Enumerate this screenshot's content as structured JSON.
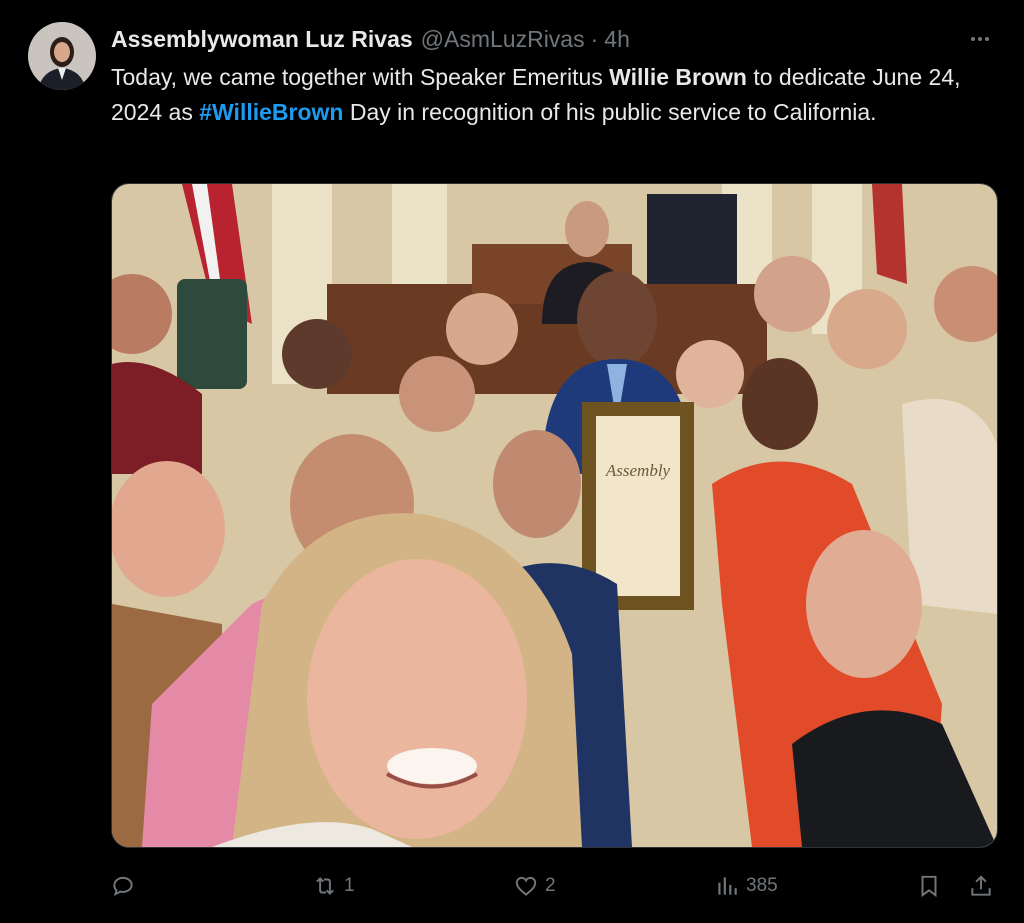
{
  "tweet": {
    "author_name": "Assemblywoman Luz Rivas",
    "handle": "@AsmLuzRivas",
    "separator": "·",
    "time": "4h",
    "text_part1": "Today, we came together with Speaker Emeritus ",
    "bold_name": "Willie Brown",
    "text_part2": " to dedicate June 24, 2024 as ",
    "hashtag": "#WillieBrown",
    "text_part3": " Day in recognition of his public service to California."
  },
  "photo": {
    "plaque_text": "Assembly"
  },
  "actions": {
    "replies": "",
    "reposts": "1",
    "likes": "2",
    "views": "385"
  },
  "icons": [
    "more-icon",
    "reply-icon",
    "repost-icon",
    "like-icon",
    "views-icon",
    "bookmark-icon",
    "share-icon"
  ],
  "colors": {
    "background": "#000000",
    "text": "#e7e9ea",
    "muted": "#71767b",
    "link": "#1d9bf0"
  }
}
